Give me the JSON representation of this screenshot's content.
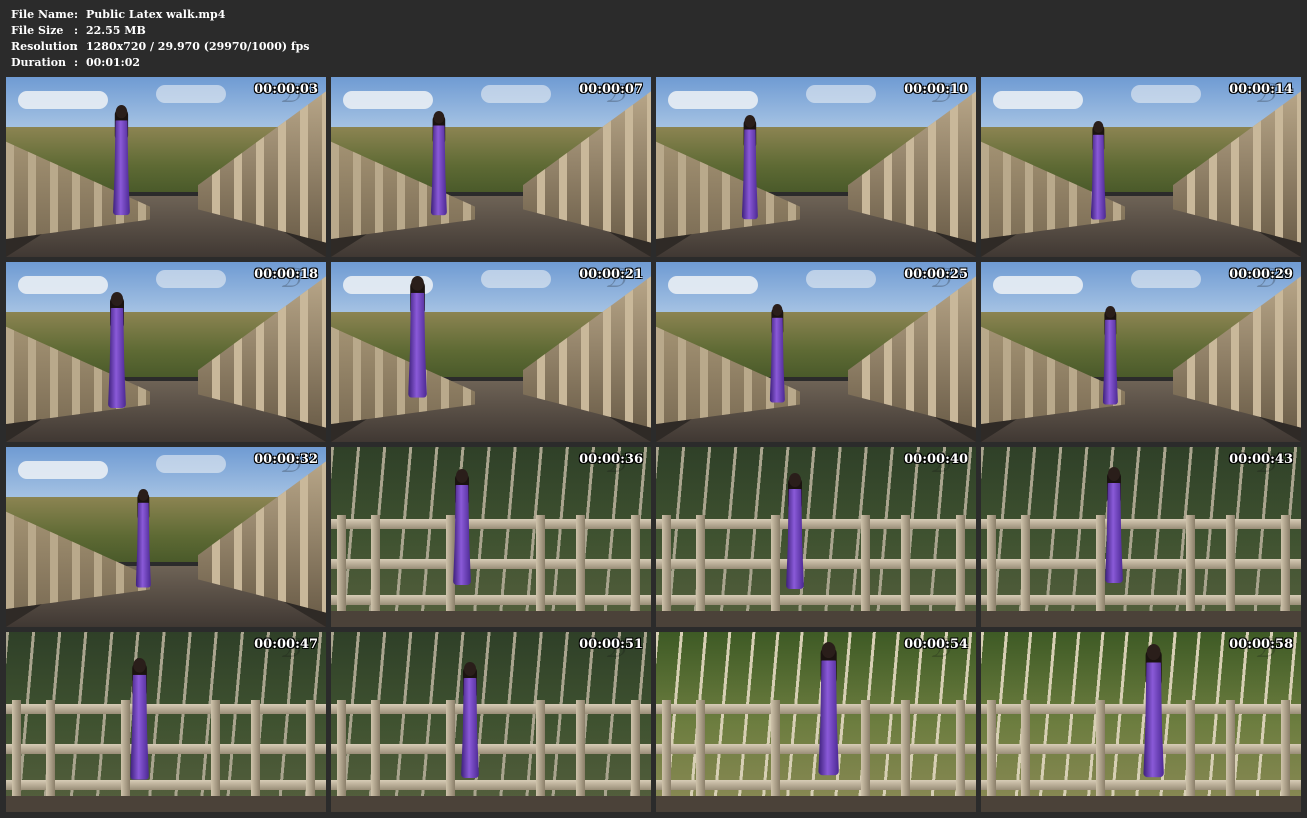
{
  "info": [
    {
      "label": "File Name",
      "sep": ":",
      "value": "Public Latex walk.mp4"
    },
    {
      "label": "File Size",
      "sep": ":",
      "value": "22.55 MB"
    },
    {
      "label": "Resolution",
      "sep": ":",
      "value": "1280x720 / 29.970 (29970/1000) fps"
    },
    {
      "label": "Duration",
      "sep": ":",
      "value": "00:01:02"
    }
  ],
  "thumbnails": [
    {
      "time": "00:00:03",
      "scene": "bridge"
    },
    {
      "time": "00:00:07",
      "scene": "bridge"
    },
    {
      "time": "00:00:10",
      "scene": "bridge"
    },
    {
      "time": "00:00:14",
      "scene": "bridge"
    },
    {
      "time": "00:00:18",
      "scene": "bridge"
    },
    {
      "time": "00:00:21",
      "scene": "bridge"
    },
    {
      "time": "00:00:25",
      "scene": "bridge"
    },
    {
      "time": "00:00:29",
      "scene": "bridge"
    },
    {
      "time": "00:00:32",
      "scene": "bridge"
    },
    {
      "time": "00:00:36",
      "scene": "fence"
    },
    {
      "time": "00:00:40",
      "scene": "fence"
    },
    {
      "time": "00:00:43",
      "scene": "fence"
    },
    {
      "time": "00:00:47",
      "scene": "fence"
    },
    {
      "time": "00:00:51",
      "scene": "fence"
    },
    {
      "time": "00:00:54",
      "scene": "fence-bright"
    },
    {
      "time": "00:00:58",
      "scene": "fence-bright"
    }
  ]
}
